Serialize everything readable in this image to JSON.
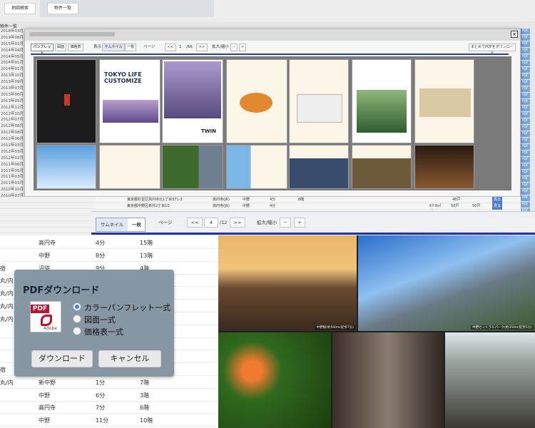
{
  "top": {
    "tab_map": "地図検索",
    "tab_list": "物件一覧"
  },
  "list_header": "物件一覧",
  "dates": [
    "2018年03月",
    "2019年08月",
    "2015年01月",
    "2014年09月",
    "2014年05月",
    "2014年01月",
    "2014年01月",
    "2013年10月",
    "2013年09月",
    "2013年07月",
    "2013年06月",
    "2013年05月",
    "2012年12月",
    "2012年10月",
    "2012年07月",
    "2012年08月",
    "2012年08月",
    "2012年06月",
    "2012年03月",
    "2012年03月",
    "2012年02月",
    "2011年06月",
    "2011年05月",
    "2011年03月",
    "2011年03月",
    "2010年10月",
    "2010年07月",
    "2009年11月",
    "2009年07月"
  ],
  "pdf_label": "PDF",
  "modal": {
    "close": "×",
    "tabs": [
      "パンフレット",
      "図面",
      "価格表"
    ],
    "view_label": "表示",
    "view_thumb": "サムネイル",
    "view_one": "一枚",
    "page_label": "ページ",
    "prev": "<<",
    "page_value": "1",
    "page_total": "/66",
    "next": ">>",
    "zoom_label": "拡大/縮小",
    "zoom_minus": "－",
    "zoom_plus": "＋",
    "download_all": "まとめてPDFをダウンロード",
    "brochure_title": "TOKYO LIFE CUSTOMIZE",
    "brochure_logo": "TWIN"
  },
  "midlist": {
    "addr1": "東京都杉並区高円寺北1丁目371-3",
    "addr2": "東京都中野区新井2丁目10",
    "l1a": "高円寺(JR)",
    "l1b": "中野",
    "l1c": "4分",
    "l1d": "8階",
    "l2a": "高円寺(JR)",
    "l2b": "中野",
    "l2c": "4分",
    "price": "67.8㎡",
    "p2": "50戸",
    "p3": "50戸",
    "p4": "48戸",
    "btn": "見る"
  },
  "viewer": {
    "thumb": "サムネイル",
    "one": "一枚",
    "page_label": "ページ",
    "prev": "<<",
    "page_value": "4",
    "page_total": "/12",
    "next": ">>",
    "zoom_label": "拡大/縮小",
    "zoom_minus": "－",
    "zoom_plus": "＋",
    "caption1": "中野駅(約560m/徒歩7分)",
    "caption2": "中野セントラルパーク(約350m/徒歩5分)"
  },
  "left_rows": [
    {
      "a": "",
      "b": "高円寺",
      "c": "4分",
      "d": "15階"
    },
    {
      "a": "",
      "b": "中野",
      "c": "8分",
      "d": "13階"
    },
    {
      "a": "宿",
      "b": "沼袋",
      "c": "9分",
      "d": "4階"
    },
    {
      "a": "丸/内",
      "b": "",
      "c": "",
      "d": ""
    },
    {
      "a": "丸/内",
      "b": "",
      "c": "",
      "d": ""
    },
    {
      "a": "丸/内",
      "b": "",
      "c": "",
      "d": ""
    },
    {
      "a": "丸/内",
      "b": "",
      "c": "",
      "d": ""
    },
    {
      "a": "",
      "b": "",
      "c": "",
      "d": ""
    },
    {
      "a": "",
      "b": "",
      "c": "",
      "d": ""
    },
    {
      "a": "",
      "b": "",
      "c": "",
      "d": ""
    },
    {
      "a": "宿",
      "b": "新井",
      "c": "7分",
      "d": "8階"
    },
    {
      "a": "丸/内",
      "b": "新中野",
      "c": "1分",
      "d": "7階"
    },
    {
      "a": "",
      "b": "中野",
      "c": "6分",
      "d": "3階"
    },
    {
      "a": "",
      "b": "高円寺",
      "c": "7分",
      "d": "6階"
    },
    {
      "a": "",
      "b": "中野",
      "c": "11分",
      "d": "10階"
    }
  ],
  "dialog": {
    "title": "PDFダウンロード",
    "pdf_icon_text": "PDF",
    "pdf_icon_sub": "Adobe",
    "options": [
      "カラーパンフレット一式",
      "図面一式",
      "価格表一式"
    ],
    "selected_index": 0,
    "download": "ダウンロード",
    "cancel": "キャンセル"
  }
}
